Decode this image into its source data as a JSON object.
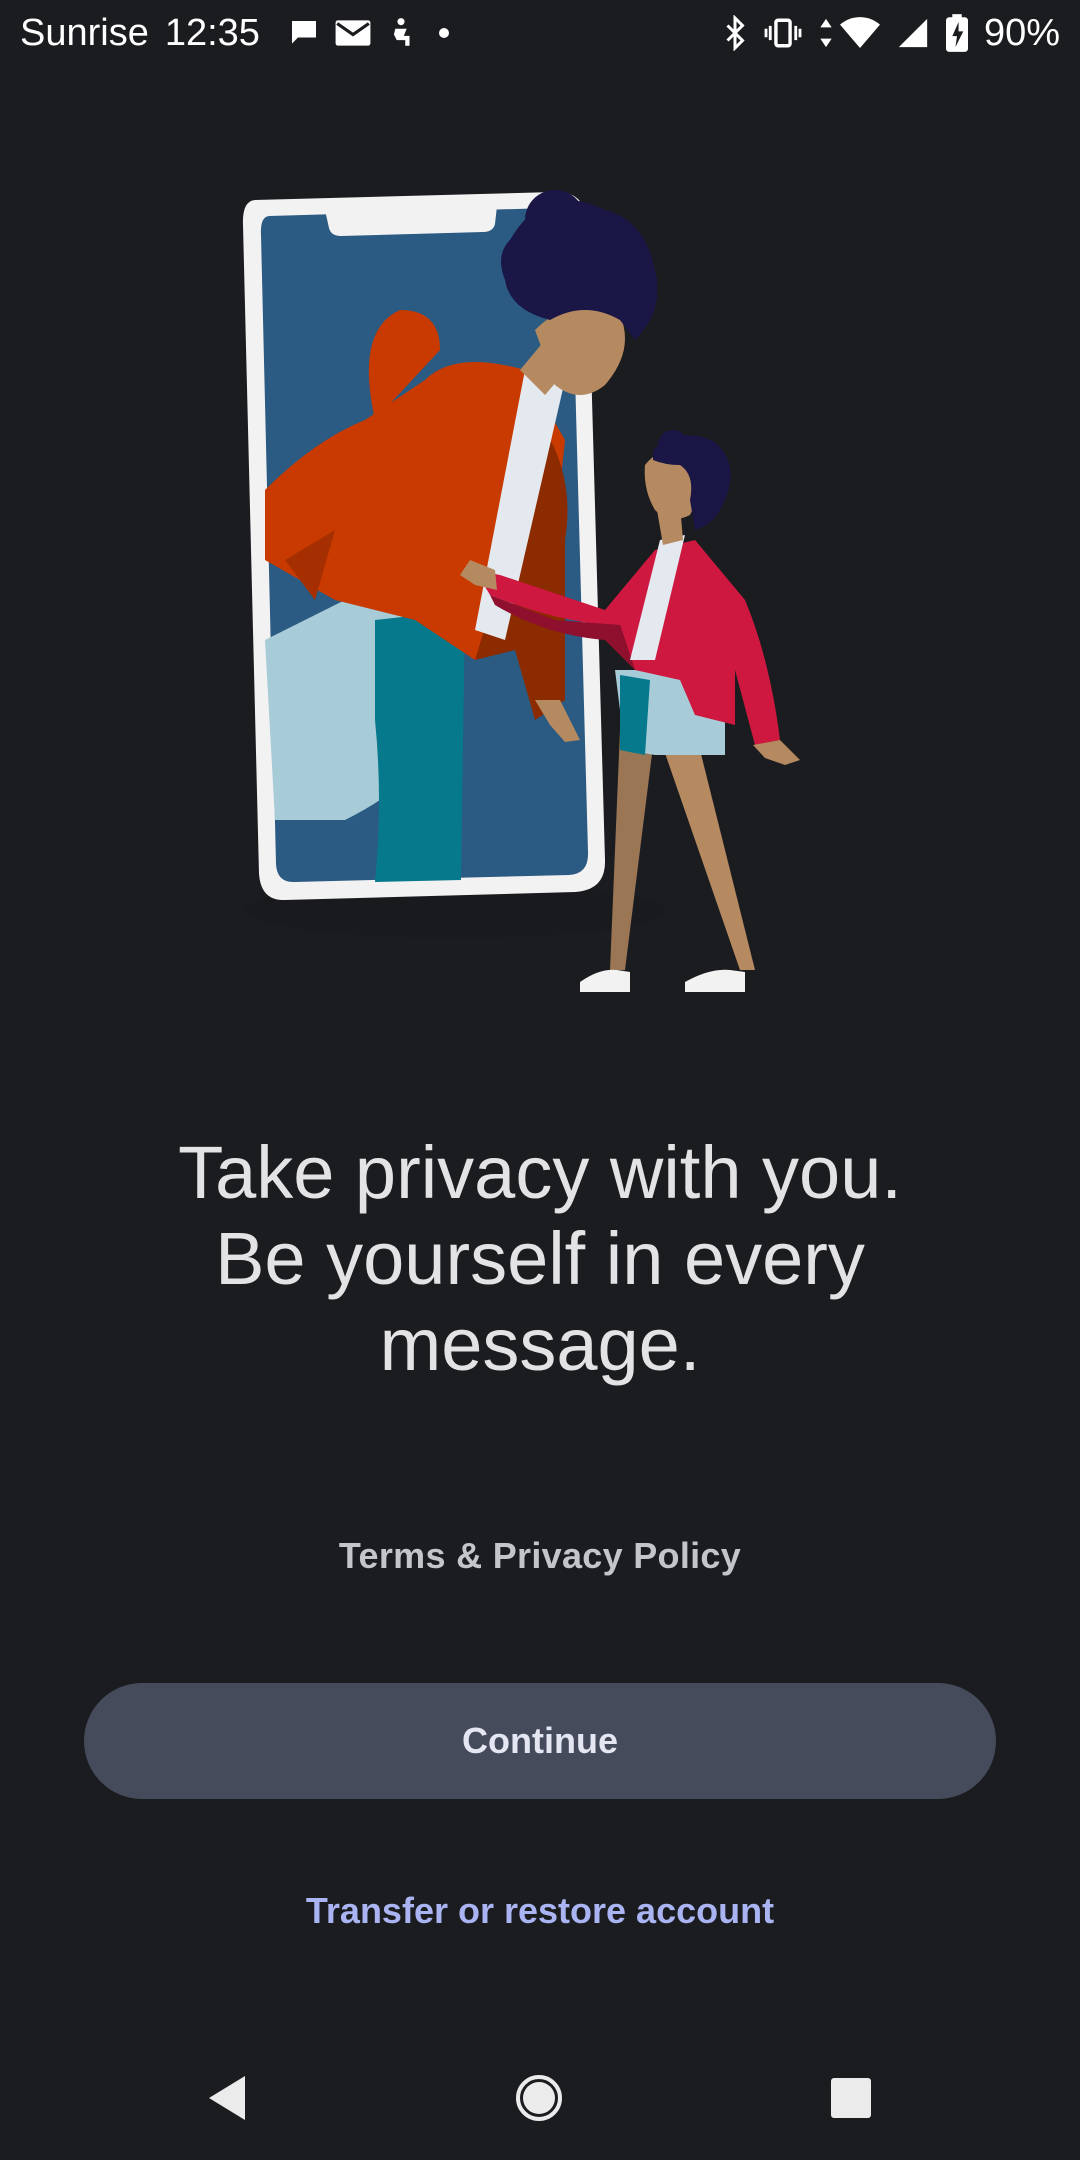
{
  "status_bar": {
    "carrier": "Sunrise",
    "time": "12:35",
    "battery": "90%",
    "left_icons": [
      "chat-bubble-icon",
      "mail-icon",
      "accessibility-icon",
      "notification-dot-icon"
    ],
    "right_icons": [
      "bluetooth-icon",
      "vibrate-icon",
      "data-arrows-icon",
      "wifi-icon",
      "cell-signal-icon",
      "battery-charging-icon"
    ]
  },
  "illustration": {
    "description_icon": "phone-people-illustration",
    "colors": {
      "phone_frame": "#f2f2f2",
      "phone_screen": "#2b5a82",
      "jacket": "#c93a00",
      "jacket_shadow": "#8c2a00",
      "pants_light": "#a7ccd8",
      "pants_teal": "#06798c",
      "hair": "#1a1646",
      "skin": "#b58a60",
      "kid_jacket": "#cf1840",
      "kid_jacket_dark": "#8e0f2e"
    }
  },
  "headline": {
    "line1": "Take privacy with you.",
    "line2": "Be yourself in every",
    "line3": "message."
  },
  "links": {
    "terms": "Terms & Privacy Policy",
    "transfer": "Transfer or restore account"
  },
  "buttons": {
    "continue": "Continue"
  },
  "nav": {
    "icons": [
      "back-icon",
      "home-icon",
      "recents-icon"
    ]
  },
  "colors": {
    "background": "#1b1c1f",
    "button": "#464b5c",
    "link_accent": "#aab4f2"
  }
}
